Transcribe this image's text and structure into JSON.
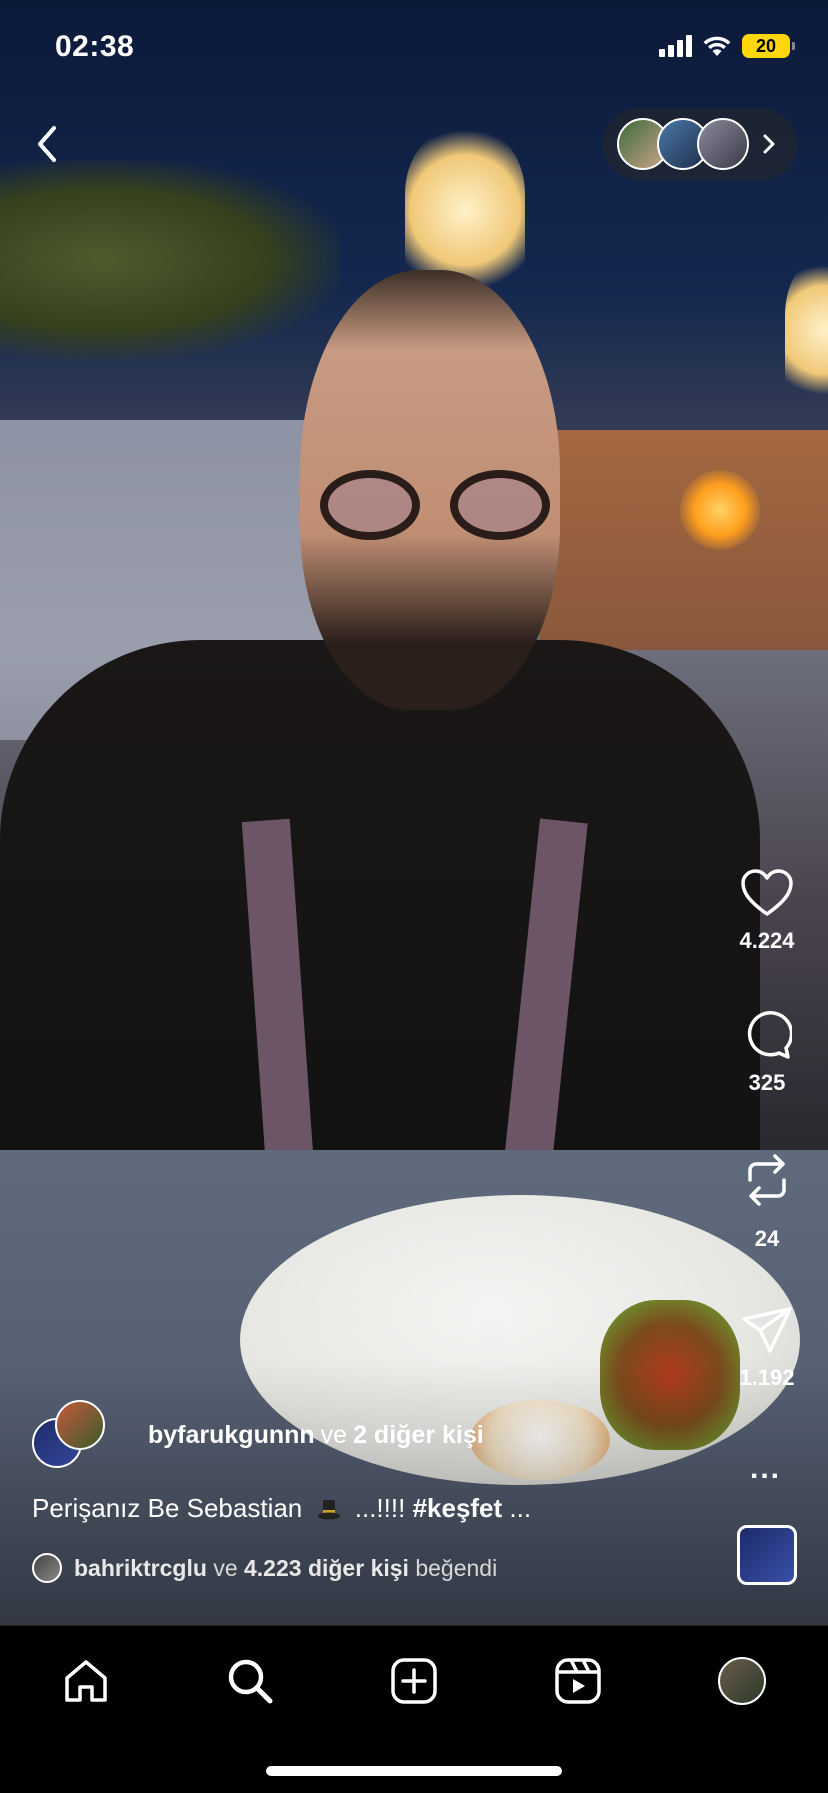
{
  "status_bar": {
    "time": "02:38",
    "battery": "20"
  },
  "author": {
    "username": "byfarukgunnn",
    "connector": "ve",
    "others": "2 diğer kişi"
  },
  "caption": {
    "text": "Perişanız Be Sebastian",
    "tail": "...!!!!",
    "hashtag": "#keşfet",
    "ellipsis": "..."
  },
  "liked_by": {
    "username": "bahriktrcglu",
    "connector": "ve",
    "others": "4.223 diğer kişi",
    "suffix": "beğendi"
  },
  "actions": {
    "likes": "4.224",
    "comments": "325",
    "reposts": "24",
    "shares": "1.192",
    "more": "..."
  },
  "nav": [
    "home-icon",
    "search-icon",
    "create-icon",
    "reels-icon",
    "profile-avatar"
  ]
}
